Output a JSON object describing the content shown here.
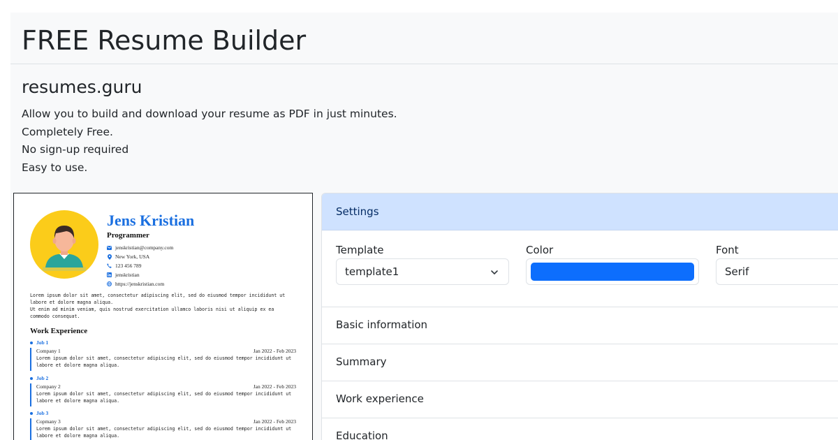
{
  "hero": {
    "title": "FREE Resume Builder",
    "subtitle": "resumes.guru",
    "lines": [
      "Allow you to build and download your resume as PDF in just minutes.",
      "Completely Free.",
      "No sign-up required",
      "Easy to use."
    ]
  },
  "resume": {
    "name": "Jens Kristian",
    "role": "Programmer",
    "accent_color": "#1a6fe0",
    "avatar_bg": "#fbcc1a",
    "contacts": [
      {
        "icon": "envelope-icon",
        "text": "jenskristian@company.com"
      },
      {
        "icon": "map-pin-icon",
        "text": "New York, USA"
      },
      {
        "icon": "phone-icon",
        "text": "123 456 789"
      },
      {
        "icon": "linkedin-icon",
        "text": "jenskristian"
      },
      {
        "icon": "globe-icon",
        "text": "https://jenskristian.com"
      }
    ],
    "summary": [
      "Lorem ipsum dolor sit amet, consectetur adipiscing elit, sed do eiusmod tempor incididunt ut",
      "labore et dolore magna aliqua.",
      "Ut enim ad minim veniam, quis nostrud exercitation ullamco laboris nisi ut aliquip ex ea",
      "commodo consequat."
    ],
    "work_title": "Work Experience",
    "jobs": [
      {
        "title": "Job 1",
        "company": "Company 1",
        "dates": "Jan 2022 - Feb 2023",
        "desc": [
          "Lorem ipsum dolor sit amet, consectetur adipiscing elit, sed do eiusmod tempor incididunt ut",
          "labore et dolore magna aliqua."
        ]
      },
      {
        "title": "Job 2",
        "company": "Company 2",
        "dates": "Jan 2022 - Feb 2023",
        "desc": [
          "Lorem ipsum dolor sit amet, consectetur adipiscing elit, sed do eiusmod tempor incididunt ut",
          "labore et dolore magna aliqua."
        ]
      },
      {
        "title": "Job 3",
        "company": "Copmany 3",
        "dates": "Jan 2022 - Feb 2023",
        "desc": [
          "Lorem ipsum dolor sit amet, consectetur adipiscing elit, sed do eiusmod tempor incididunt ut",
          "labore et dolore magna aliqua."
        ]
      }
    ]
  },
  "settings": {
    "header": "Settings",
    "template_label": "Template",
    "template_value": "template1",
    "color_label": "Color",
    "color_value": "#0d6efd",
    "font_label": "Font",
    "font_value": "Serif"
  },
  "sections": [
    "Basic information",
    "Summary",
    "Work experience",
    "Education"
  ]
}
